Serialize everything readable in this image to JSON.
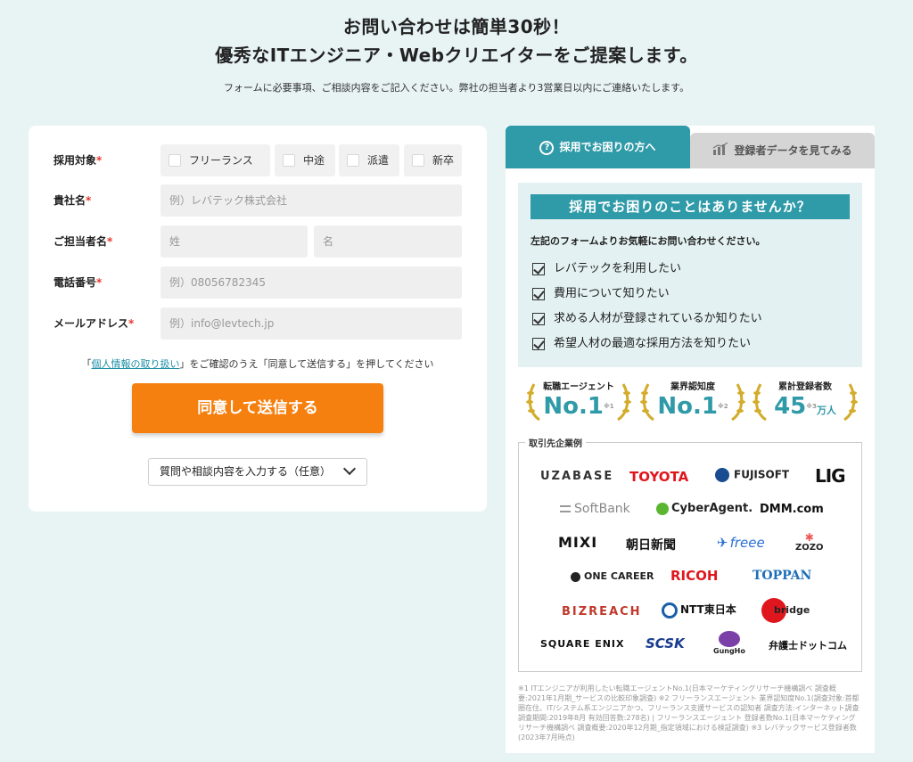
{
  "header": {
    "line1": "お問い合わせは簡単30秒！",
    "line2": "優秀なITエンジニア・Webクリエイターをご提案します。",
    "subtitle": "フォームに必要事項、ご相談内容をご記入ください。弊社の担当者より3営業日以内にご連絡いたします。"
  },
  "form": {
    "target_label": "採用対象",
    "required_mark": "*",
    "target_options": [
      "フリーランス",
      "中途",
      "派遣",
      "新卒"
    ],
    "company_label": "貴社名",
    "company_placeholder": "例）レバテック株式会社",
    "contact_label": "ご担当者名",
    "last_name_placeholder": "姓",
    "first_name_placeholder": "名",
    "phone_label": "電話番号",
    "phone_placeholder": "例）08056782345",
    "email_label": "メールアドレス",
    "email_placeholder": "例）info@levtech.jp",
    "privacy_prefix": "「",
    "privacy_link": "個人情報の取り扱い",
    "privacy_suffix": "」をご確認のうえ「同意して送信する」を押してください",
    "submit_label": "同意して送信する",
    "expand_label": "質問や相談内容を入力する（任意）"
  },
  "panel": {
    "tab_active": "採用でお困りの方へ",
    "tab_inactive": "登録者データを見てみる",
    "banner": "採用でお困りのことはありませんか？",
    "lead": "左記のフォームよりお気軽にお問い合わせください。",
    "checks": [
      "レバテックを利用したい",
      "費用について知りたい",
      "求める人材が登録されているか知りたい",
      "希望人材の最適な採用方法を知りたい"
    ],
    "awards": [
      {
        "caption": "転職エージェント",
        "value": "No.1",
        "note": "※1",
        "unit": ""
      },
      {
        "caption": "業界認知度",
        "value": "No.1",
        "note": "※2",
        "unit": ""
      },
      {
        "caption": "累計登録者数",
        "value": "45",
        "note": "※3",
        "unit": "万人"
      }
    ],
    "clients_title": "取引先企業例",
    "logos": {
      "uzabase": "UZABASE",
      "toyota": "TOYOTA",
      "fujisoft": "FUJISOFT",
      "lig": "LIG",
      "softbank": "SoftBank",
      "cyberagent": "CyberAgent.",
      "dmm": "DMM.com",
      "mixi": "MIXI",
      "asahi": "朝日新聞",
      "freee": "freee",
      "zozo": "ZOZO",
      "onecareer": "ONE CAREER",
      "ricoh": "RICOH",
      "toppan": "TOPPAN",
      "bizreach": "BIZREACH",
      "ntt": "NTT東日本",
      "bridge": "bridge",
      "squareenix": "SQUARE ENIX",
      "scsk": "SCSK",
      "gungho": "GungHo",
      "bengoshi": "弁護士ドットコム"
    },
    "footnote": "※1 ITエンジニアが利用したい転職エージェントNo.1(日本マーケティングリサーチ機構調べ 調査概要:2021年1月期_サービスの比較印象調査) ※2 フリーランスエージェント 業界認知度No.1(調査対象:首都圏在住、IT/システム系エンジニアかつ、フリーランス支援サービスの認知者 調査方法:インターネット調査 調査期間:2019年8月 有効回答数:278名) | フリーランスエージェント 登録者数No.1(日本マーケティングリサーチ機構調べ 調査概要:2020年12月期_指定領域における検証調査) ※3 レバテックサービス登録者数(2023年7月時点)"
  },
  "colors": {
    "background": "#e8f3f4",
    "teal": "#2f9aa8",
    "orange": "#f5800f",
    "required": "#e8392b"
  }
}
